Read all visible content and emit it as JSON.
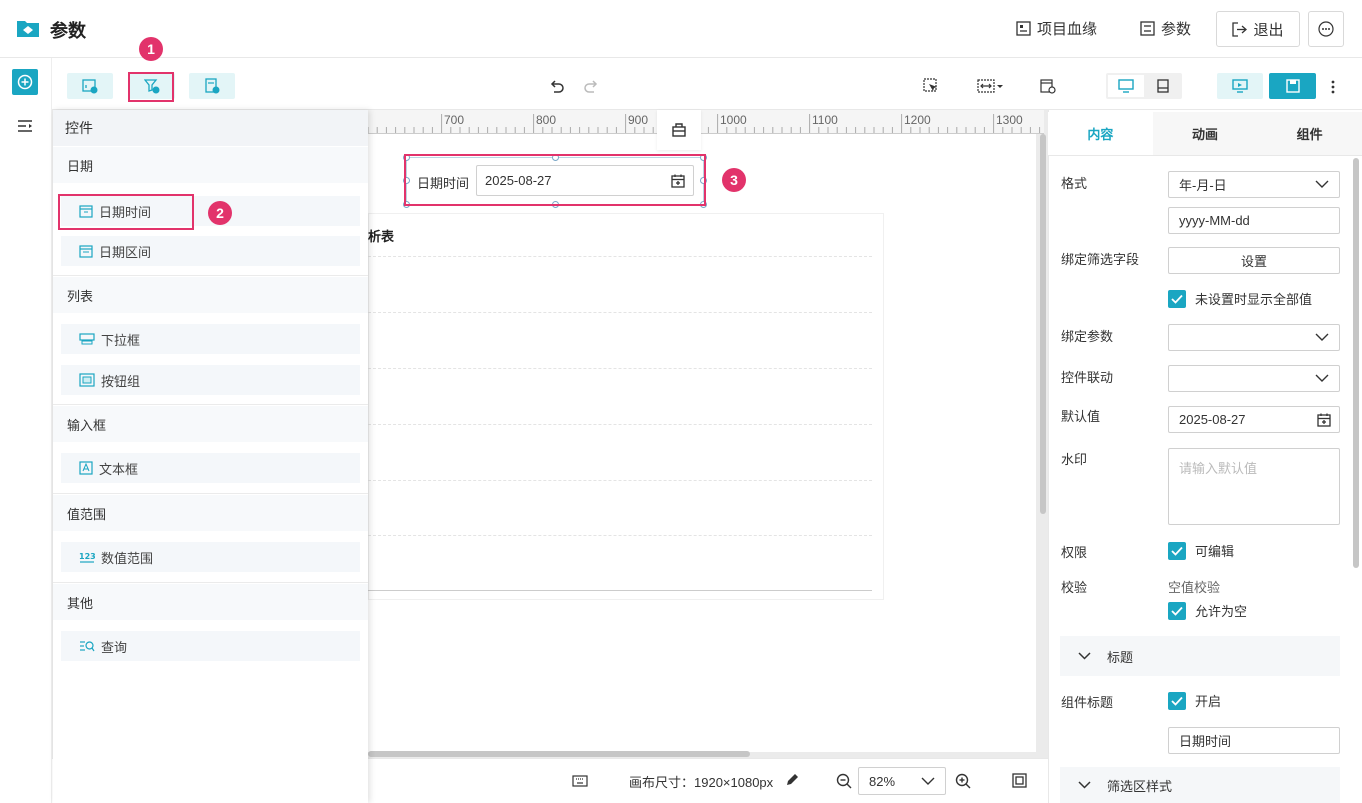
{
  "header": {
    "title": "参数",
    "lineage_label": "项目血缘",
    "params_label": "参数",
    "exit_label": "退出"
  },
  "ruler": {
    "ticks": [
      "700",
      "800",
      "900",
      "1000",
      "1100",
      "1200",
      "1300"
    ]
  },
  "canvas": {
    "table_title_fragment": "析表",
    "widget_label": "日期时间",
    "widget_value": "2025-08-27",
    "canvas_size": "画布尺寸：1920×1080px",
    "zoom": "82%"
  },
  "badges": [
    "1",
    "2",
    "3"
  ],
  "controls": {
    "header": "控件",
    "groups": [
      {
        "title": "日期",
        "items": [
          "日期时间",
          "日期区间"
        ]
      },
      {
        "title": "列表",
        "items": [
          "下拉框",
          "按钮组"
        ]
      },
      {
        "title": "输入框",
        "items": [
          "文本框"
        ]
      },
      {
        "title": "值范围",
        "items": [
          "数值范围"
        ]
      },
      {
        "title": "其他",
        "items": [
          "查询"
        ]
      }
    ]
  },
  "props": {
    "tabs": [
      "内容",
      "动画",
      "组件"
    ],
    "format_label": "格式",
    "format_value": "年-月-日",
    "format_pattern": "yyyy-MM-dd",
    "bind_field_label": "绑定筛选字段",
    "set_button": "设置",
    "show_all_label": "未设置时显示全部值",
    "bind_param_label": "绑定参数",
    "linkage_label": "控件联动",
    "default_label": "默认值",
    "default_value": "2025-08-27",
    "watermark_label": "水印",
    "watermark_placeholder": "请输入默认值",
    "permission_label": "权限",
    "editable_label": "可编辑",
    "validate_label": "校验",
    "null_check_label": "空值校验",
    "allow_null_label": "允许为空",
    "title_section": "标题",
    "comp_title_label": "组件标题",
    "enable_label": "开启",
    "comp_title_value": "日期时间",
    "filter_style_section": "筛选区样式"
  },
  "colors": {
    "accent": "#1aa6c2",
    "highlight": "#e2336b"
  }
}
